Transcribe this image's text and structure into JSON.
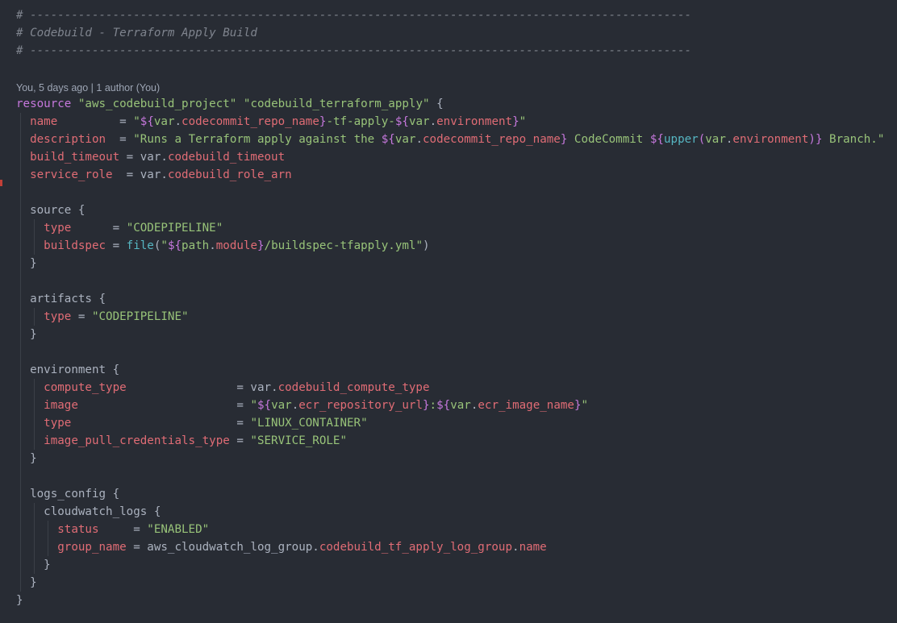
{
  "comments": {
    "rule": "# ------------------------------------------------------------------------------------------------",
    "title": "# Codebuild - Terraform Apply Build"
  },
  "blame": "You, 5 days ago | 1 author (You)",
  "resource": {
    "keyword": "resource",
    "type": "\"aws_codebuild_project\"",
    "name": "\"codebuild_terraform_apply\"",
    "open": " {"
  },
  "attrs": {
    "name_key": "name",
    "name_eq": "         = ",
    "description_key": "description",
    "description_eq": "  = ",
    "build_timeout_key": "build_timeout",
    "build_timeout_eq": " = ",
    "service_role_key": "service_role",
    "service_role_eq": "  = "
  },
  "values": {
    "name": {
      "q1": "\"",
      "d1": "${",
      "v1": "var",
      "dot1": ".",
      "p1": "codecommit_repo_name",
      "c1": "}",
      "lit": "-tf-apply-",
      "d2": "${",
      "v2": "var",
      "dot2": ".",
      "p2": "environment",
      "c2": "}",
      "q2": "\""
    },
    "description": {
      "lit1": "\"Runs a Terraform apply against the ",
      "d1": "${",
      "v1": "var",
      "dot1": ".",
      "p1": "codecommit_repo_name",
      "c1": "}",
      "lit2": " CodeCommit ",
      "d2": "${",
      "fn": "upper",
      "open": "(",
      "v2": "var",
      "dot2": ".",
      "p2": "environment",
      "close": ")",
      "c2": "}",
      "lit3": " Branch.\""
    },
    "build_timeout": {
      "v": "var",
      "dot": ".",
      "p": "codebuild_timeout"
    },
    "service_role": {
      "v": "var",
      "dot": ".",
      "p": "codebuild_role_arn"
    }
  },
  "source": {
    "header": "source {",
    "type_key": "type",
    "type_eq": "      = ",
    "type_val": "\"CODEPIPELINE\"",
    "buildspec_key": "buildspec",
    "buildspec_eq": " = ",
    "fn": "file",
    "open": "(",
    "q1": "\"",
    "d1": "${",
    "path_obj": "path",
    "dot": ".",
    "path_prop": "module",
    "c1": "}",
    "lit": "/buildspec-tfapply.yml",
    "q2": "\"",
    "close": ")",
    "end": "}"
  },
  "artifacts": {
    "header": "artifacts {",
    "type_key": "type",
    "type_eq": " = ",
    "type_val": "\"CODEPIPELINE\"",
    "end": "}"
  },
  "environment": {
    "header": "environment {",
    "compute_key": "compute_type",
    "compute_eq": "                = ",
    "compute_v": "var",
    "compute_dot": ".",
    "compute_p": "codebuild_compute_type",
    "image_key": "image",
    "image_eq": "                       = ",
    "image_q1": "\"",
    "image_d1": "${",
    "image_v1": "var",
    "image_dot1": ".",
    "image_p1": "ecr_repository_url",
    "image_c1": "}",
    "image_colon": ":",
    "image_d2": "${",
    "image_v2": "var",
    "image_dot2": ".",
    "image_p2": "ecr_image_name",
    "image_c2": "}",
    "image_q2": "\"",
    "type_key": "type",
    "type_eq": "                        = ",
    "type_val": "\"LINUX_CONTAINER\"",
    "ipc_key": "image_pull_credentials_type",
    "ipc_eq": " = ",
    "ipc_val": "\"SERVICE_ROLE\"",
    "end": "}"
  },
  "logs_config": {
    "header": "logs_config {",
    "cw_header": "cloudwatch_logs {",
    "status_key": "status",
    "status_eq": "     = ",
    "status_val": "\"ENABLED\"",
    "group_key": "group_name",
    "group_eq": " = ",
    "group_obj": "aws_cloudwatch_log_group",
    "group_dot1": ".",
    "group_p1": "codebuild_tf_apply_log_group",
    "group_dot2": ".",
    "group_p2": "name",
    "cw_end": "}",
    "end": "}"
  },
  "resource_end": "}",
  "colors": {
    "background": "#282c34",
    "comment": "#7f848e",
    "keyword": "#c678dd",
    "string": "#98c379",
    "property": "#e06c75",
    "function": "#56b6c2",
    "text": "#abb2bf",
    "gutter_marker": "#c24038"
  }
}
